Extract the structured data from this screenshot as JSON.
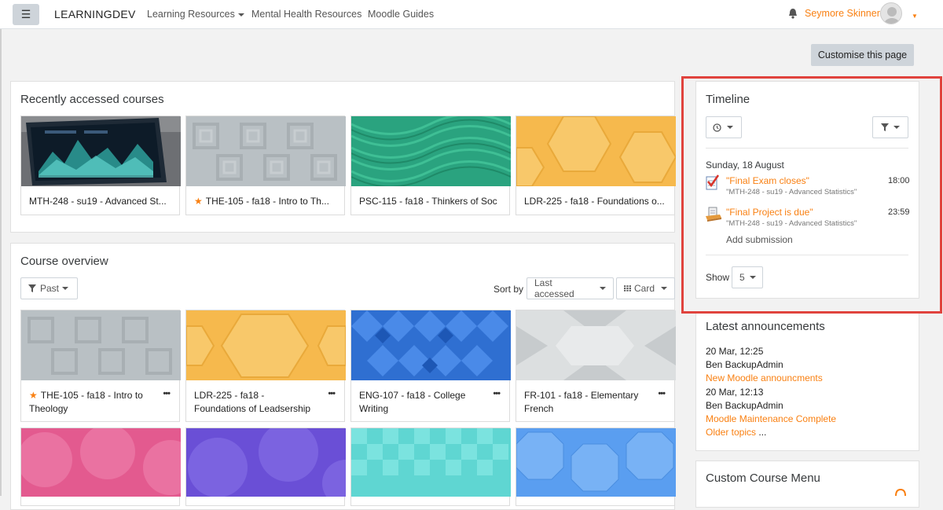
{
  "nav": {
    "brand": "LEARNINGDEV",
    "links": [
      "Learning Resources",
      "Mental Health Resources",
      "Moodle Guides"
    ],
    "user": "Seymore Skinner",
    "menu_icon": "hamburger-icon"
  },
  "customise_label": "Customise this page",
  "recent": {
    "title": "Recently accessed courses",
    "courses": [
      {
        "name": "MTH-248 - su19 - Advanced St...",
        "starred": false
      },
      {
        "name": "THE-105 - fa18 - Intro to Th...",
        "starred": true
      },
      {
        "name": "PSC-115 - fa18 - Thinkers of Soc",
        "starred": false
      },
      {
        "name": "LDR-225 - fa18 - Foundations o...",
        "starred": false
      }
    ]
  },
  "overview": {
    "title": "Course overview",
    "filter": "Past",
    "sort_label": "Sort by",
    "sort_value": "Last accessed",
    "view": "Card",
    "more_icon": "•••",
    "courses": [
      {
        "line1": "THE-105 - fa18 - Intro to",
        "line2": "Theology",
        "starred": true
      },
      {
        "line1": "LDR-225 - fa18 -",
        "line2": "Foundations of Leadsership",
        "starred": false
      },
      {
        "line1": "ENG-107 - fa18 - College",
        "line2": "Writing",
        "starred": false
      },
      {
        "line1": "FR-101 - fa18 - Elementary",
        "line2": "French",
        "starred": false
      }
    ]
  },
  "timeline": {
    "title": "Timeline",
    "date": "Sunday, 18 August",
    "events": [
      {
        "title": "\"Final Exam closes\"",
        "course": "\"MTH-248 - su19 - Advanced Statistics\"",
        "time": "18:00",
        "icon": "quiz-icon"
      },
      {
        "title": "\"Final Project is due\"",
        "course": "\"MTH-248 - su19 - Advanced Statistics\"",
        "time": "23:59",
        "icon": "assignment-icon",
        "action": "Add submission"
      }
    ],
    "show_label": "Show",
    "show_value": "5"
  },
  "announcements": {
    "title": "Latest announcements",
    "items": [
      {
        "date": "20 Mar, 12:25",
        "author": "Ben BackupAdmin",
        "link": "New Moodle announcments"
      },
      {
        "date": "20 Mar, 12:13",
        "author": "Ben BackupAdmin",
        "link": "Moodle Maintenance Complete"
      }
    ],
    "older": "Older topics",
    "ellipsis": " ..."
  },
  "custom_menu": {
    "title": "Custom Course Menu"
  },
  "colors": {
    "accent": "#f98012",
    "highlight": "#e0433d"
  }
}
